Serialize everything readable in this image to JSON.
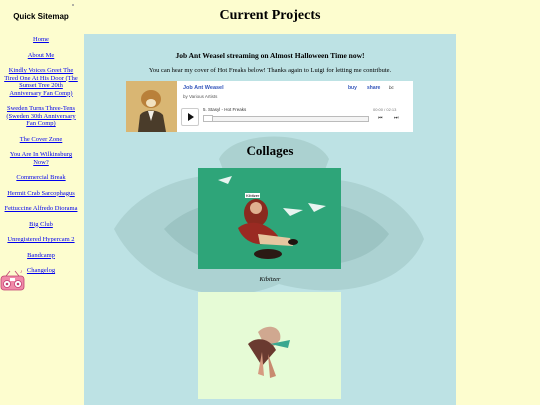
{
  "sidebar": {
    "title": "Quick Sitemap",
    "links": [
      "Home",
      "About Me",
      "Kindly Voices Greet The Tired One At His Door (The Sunset Tree 20th Anniversary Fan Comp)",
      "Sweden Turns Three-Tens (Sweden 30th Anniversary Fan Comp)",
      "The Cover Zone",
      "You Are In Wilkinsburg Now?",
      "Commercial Break",
      "Hermit Crab Sarcophagus",
      "Fettuccine Alfredo Diorama",
      "Big Club",
      "Unregistered Hypercam 2",
      "Bandcamp",
      "Changelog"
    ]
  },
  "page": {
    "title": "Current Projects"
  },
  "stream": {
    "title": "Job Ant Weasel streaming on Almost Halloween Time now!",
    "subtitle": "You can hear my cover of Hot Freaks below! Thanks again to Luigi for letting me contribute."
  },
  "player": {
    "album": "Job Ant Weasel",
    "artist": "by Various Artists",
    "buy": "buy",
    "share": "share",
    "logo": "bc",
    "track": "5. Stasyl - Hot Freaks",
    "time": "00:00 / 02:13",
    "prev": "⏮",
    "next": "⏭"
  },
  "collages": {
    "heading": "Collages",
    "items": [
      {
        "caption": "Kibitzer",
        "label": "Kibitzer",
        "bg": "#2ea579"
      },
      {
        "caption": "",
        "bg": "#e6fbd6"
      }
    ]
  },
  "colors": {
    "page_bg": "#fdfdcf",
    "main_bg": "#bde2e4",
    "link": "#0000ee"
  }
}
